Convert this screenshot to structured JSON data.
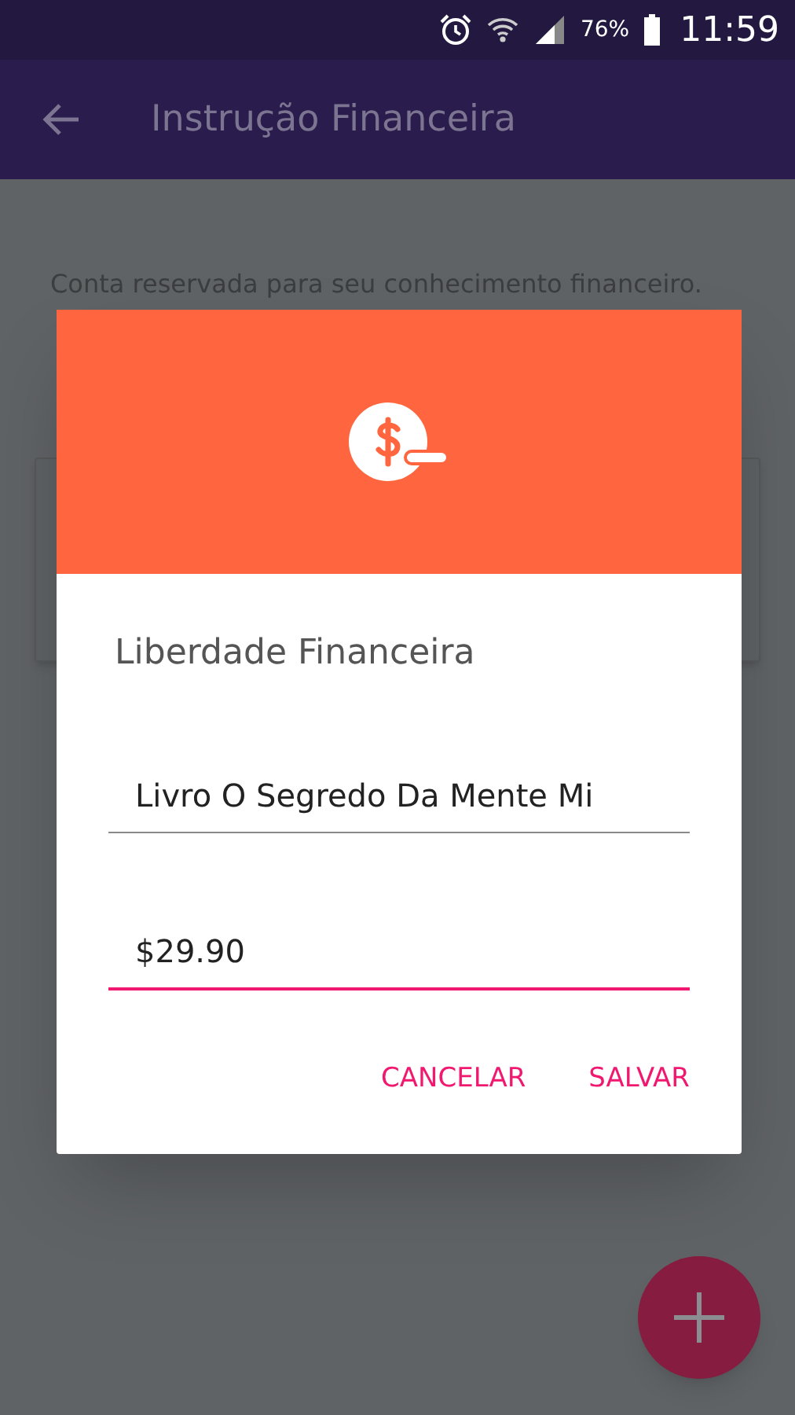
{
  "status_bar": {
    "battery": "76%",
    "time": "11:59"
  },
  "app_bar": {
    "title": "Instrução Financeira"
  },
  "content": {
    "description": "Conta reservada para seu conhecimento financeiro."
  },
  "dialog": {
    "title": "Liberdade Financeira",
    "fields": [
      {
        "value": "Livro O Segredo Da Mente Mi",
        "focused": false
      },
      {
        "value": "$29.90",
        "focused": true
      }
    ],
    "buttons": [
      "CANCELAR",
      "SALVAR"
    ]
  }
}
